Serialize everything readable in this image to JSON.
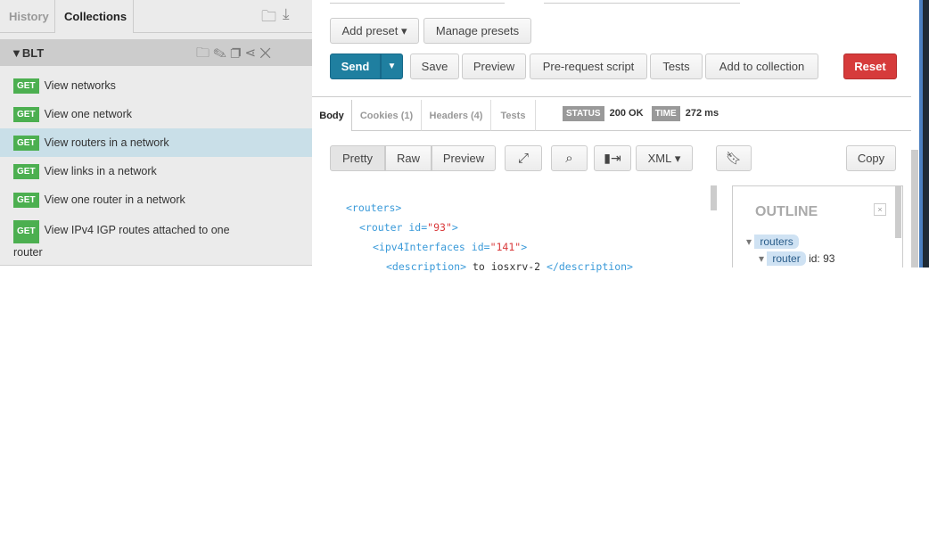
{
  "sidebar": {
    "tabs": [
      "History",
      "Collections"
    ],
    "collection": {
      "name": "BLT",
      "toggle": "▼"
    },
    "items": [
      {
        "method": "GET",
        "label": "View networks"
      },
      {
        "method": "GET",
        "label": "View one network"
      },
      {
        "method": "GET",
        "label": "View routers in a network",
        "selected": true
      },
      {
        "method": "GET",
        "label": "View links in a network"
      },
      {
        "method": "GET",
        "label": "View one router in a network"
      },
      {
        "method": "GET",
        "label": "View IPv4 IGP routes attached to one",
        "label2": "router"
      }
    ]
  },
  "toolbar": {
    "add_preset": "Add preset",
    "manage_presets": "Manage presets",
    "send": "Send",
    "save": "Save",
    "preview": "Preview",
    "prerequest": "Pre-request script",
    "tests": "Tests",
    "add_to_collection": "Add to collection",
    "reset": "Reset"
  },
  "response": {
    "tabs": [
      "Body",
      "Cookies (1)",
      "Headers (4)",
      "Tests"
    ],
    "status_label": "STATUS",
    "status": "200 OK",
    "time_label": "TIME",
    "time": "272 ms",
    "views": [
      "Pretty",
      "Raw",
      "Preview"
    ],
    "format": "XML",
    "copy": "Copy",
    "code": {
      "l1": "<routers>",
      "l2a": "<router id=",
      "l2b": "\"93\"",
      "l2c": ">",
      "l3a": "<ipv4Interfaces id=",
      "l3b": "\"141\"",
      "l3c": ">",
      "l4a": "<description>",
      "l4b": " to iosxrv-2 ",
      "l4c": "</description>"
    },
    "outline": {
      "title": "OUTLINE",
      "close": "×",
      "n1": "routers",
      "n2": "router",
      "n2id": "id: 93"
    }
  },
  "colors": {
    "send": "#1f7fa0",
    "reset": "#d63b3b",
    "get": "#4caf50",
    "selected": "#c9dfe8"
  }
}
